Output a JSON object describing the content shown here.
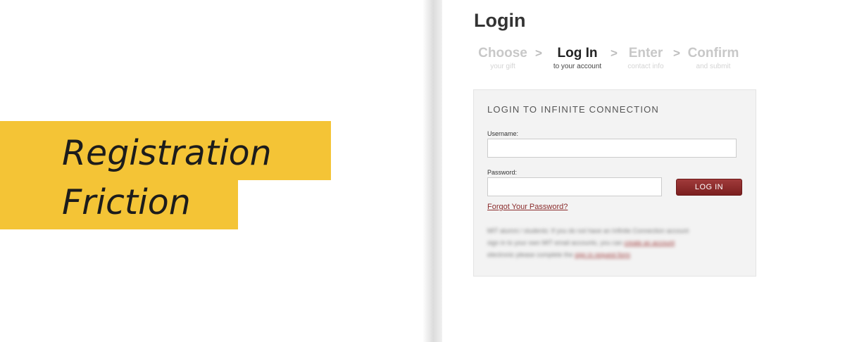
{
  "headline": {
    "line1": "Registration",
    "line2": "Friction"
  },
  "page": {
    "title": "Login",
    "steps": [
      {
        "label": "Choose",
        "sub": "your gift",
        "active": false
      },
      {
        "label": "Log In",
        "sub": "to your account",
        "active": true
      },
      {
        "label": "Enter",
        "sub": "contact info",
        "active": false
      },
      {
        "label": "Confirm",
        "sub": "and submit",
        "active": false
      }
    ],
    "step_separator": ">"
  },
  "login_box": {
    "title": "LOGIN TO INFINITE CONNECTION",
    "username_label": "Username:",
    "username_value": "",
    "password_label": "Password:",
    "password_value": "",
    "login_button": "LOG IN",
    "forgot_link": "Forgot Your Password?",
    "blurred_text": {
      "line1": "MIT alumni / students: If you do not have an Infinite Connection account",
      "line2_before": "sign in to your own MIT email accounts, you can ",
      "line2_link": "create an account",
      "line3_before": "electronic please complete the ",
      "line3_link": "sign in request form"
    }
  },
  "colors": {
    "highlight": "#f4c436",
    "button": "#8a2b2b",
    "link": "#8a2b2b"
  }
}
